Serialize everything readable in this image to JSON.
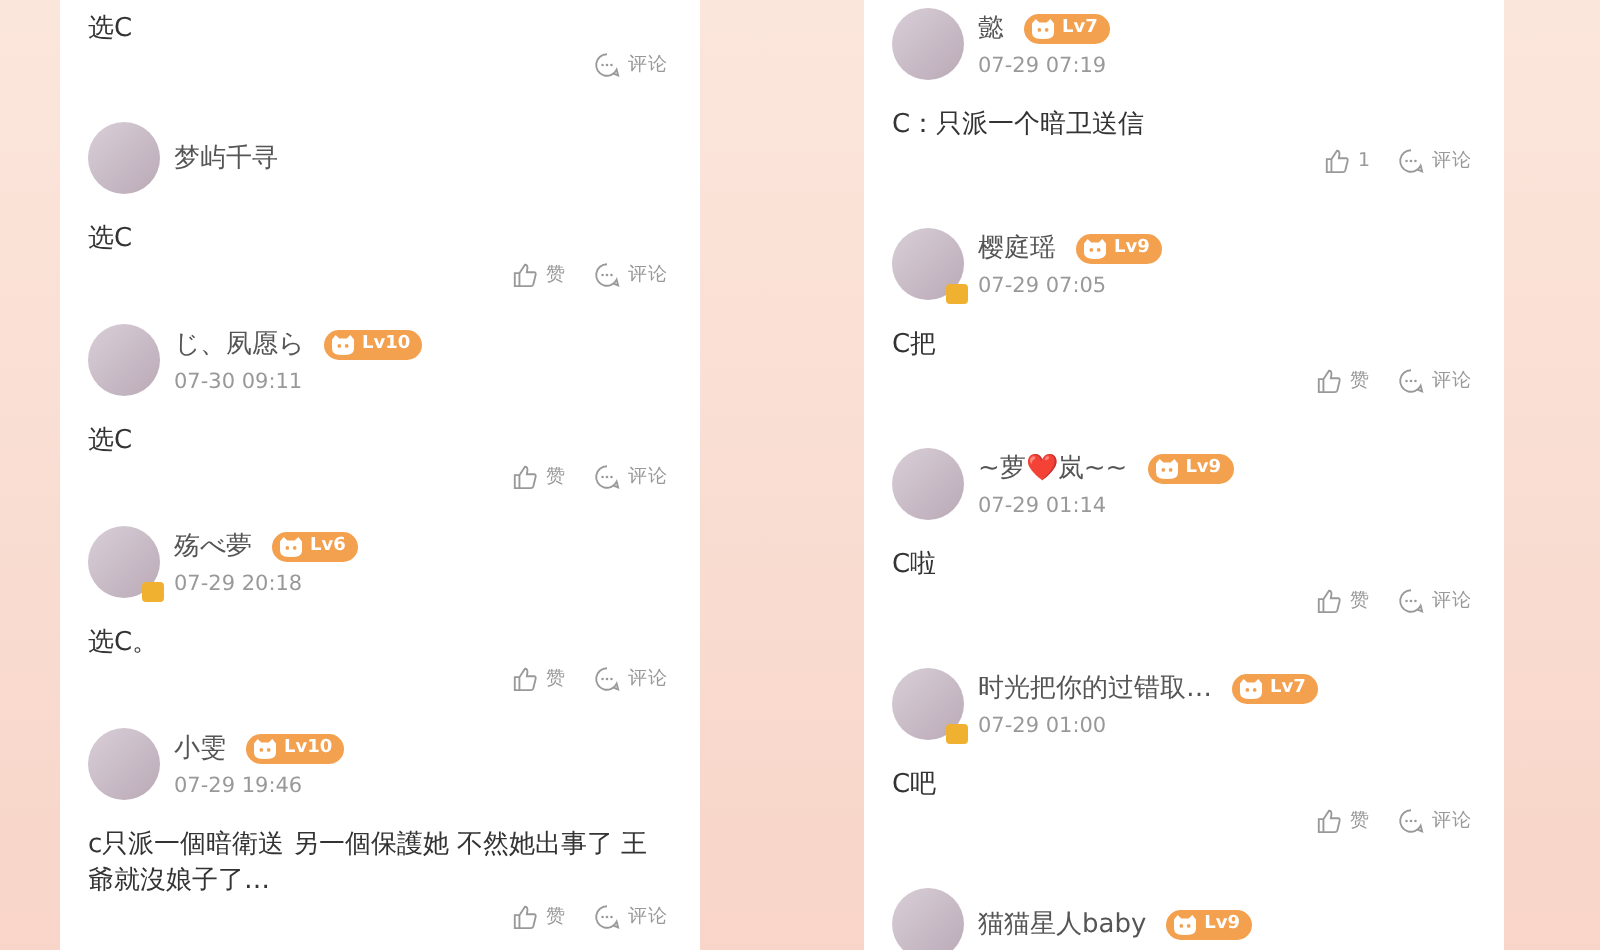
{
  "columns": [
    {
      "comments": [
        {
          "body": "选C",
          "reply": "评论"
        },
        {
          "user": {
            "name": "梦屿千寻",
            "verified": false
          },
          "body": "选C",
          "like": "赞",
          "reply": "评论"
        },
        {
          "user": {
            "name": "じ、夙愿ら",
            "level": "Lv10",
            "verified": false
          },
          "date": "07-30 09:11",
          "body": "选C",
          "like": "赞",
          "reply": "评论"
        },
        {
          "user": {
            "name": "殇べ夢",
            "level": "Lv6",
            "verified": true
          },
          "date": "07-29 20:18",
          "body": "选C。",
          "like": "赞",
          "reply": "评论"
        },
        {
          "user": {
            "name": "小雯",
            "level": "Lv10",
            "verified": false
          },
          "date": "07-29 19:46",
          "body": "c只派一個暗衛送 另一個保護她 不然她出事了 王爺就沒娘子了…",
          "like": "赞",
          "reply": "评论"
        }
      ]
    },
    {
      "comments": [
        {
          "user": {
            "name": "懿",
            "level": "Lv7",
            "verified": false
          },
          "date": "07-29 07:19",
          "body": "C：只派一个暗卫送信",
          "like": "1",
          "reply": "评论"
        },
        {
          "user": {
            "name": "樱庭瑶",
            "level": "Lv9",
            "verified": true
          },
          "date": "07-29 07:05",
          "body": "C把",
          "like": "赞",
          "reply": "评论"
        },
        {
          "user": {
            "name": "~萝❤️岚~~",
            "level": "Lv9",
            "verified": false
          },
          "date": "07-29 01:14",
          "body": "C啦",
          "like": "赞",
          "reply": "评论"
        },
        {
          "user": {
            "name": "时光把你的过错取…",
            "level": "Lv7",
            "verified": true
          },
          "date": "07-29 01:00",
          "body": "C吧",
          "like": "赞",
          "reply": "评论"
        },
        {
          "user": {
            "name": "猫猫星人baby",
            "level": "Lv9",
            "verified": false
          }
        }
      ]
    }
  ]
}
